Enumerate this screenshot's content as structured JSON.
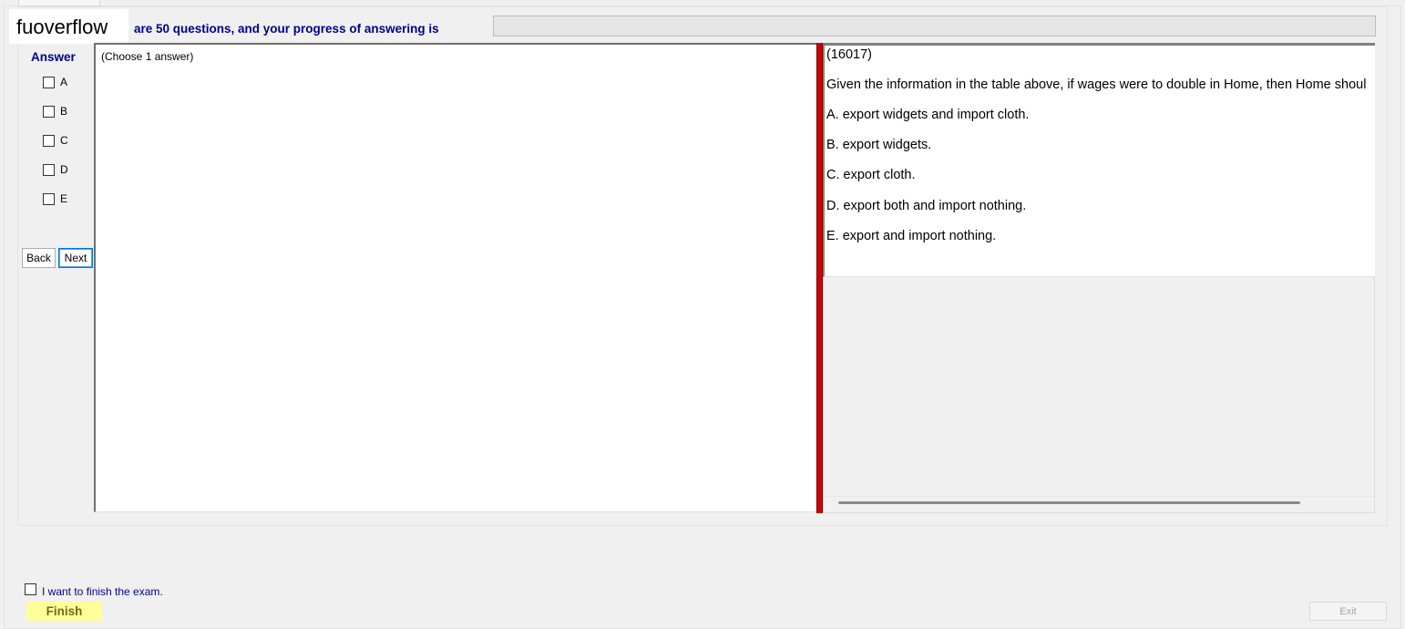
{
  "watermark": "fuoverflow",
  "header": {
    "progress_text": "are 50 questions, and your progress of answering is",
    "progress_percent": 0
  },
  "answer": {
    "label": "Answer",
    "options": [
      {
        "label": "A",
        "checked": false
      },
      {
        "label": "B",
        "checked": false
      },
      {
        "label": "C",
        "checked": false
      },
      {
        "label": "D",
        "checked": false
      },
      {
        "label": "E",
        "checked": false
      }
    ]
  },
  "nav": {
    "back_label": "Back",
    "next_label": "Next"
  },
  "middle": {
    "choose_text": "(Choose 1 answer)"
  },
  "question": {
    "id": "(16017)",
    "text": "Given the information in the table above, if wages were to double in Home, then Home shoul",
    "choices": [
      "A.  export widgets and import cloth.",
      "B.  export widgets.",
      "C.  export cloth.",
      "D.  export both and import nothing.",
      "E.  export and import nothing."
    ]
  },
  "footer": {
    "finish_checkbox_label": "I want to finish the exam.",
    "finish_label": "Finish",
    "exit_label": "Exit"
  },
  "colors": {
    "accent_text": "#00008b",
    "splitter": "#d40000",
    "finish_bg": "#ffff99"
  }
}
